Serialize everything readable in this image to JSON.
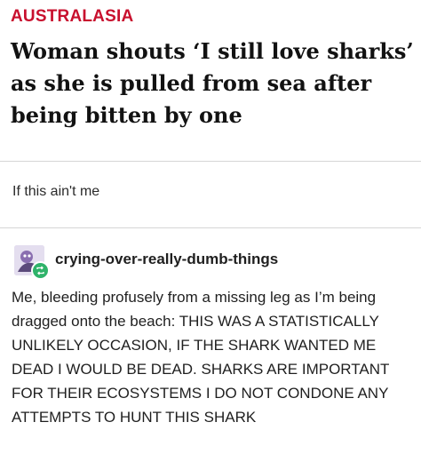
{
  "article": {
    "section": "AUSTRALASIA",
    "headline": "Woman shouts ‘I still love sharks’ as she is pulled from sea after being bitten by one"
  },
  "post": {
    "caption": "If this ain't me"
  },
  "reblog": {
    "username": "crying-over-really-dumb-things",
    "avatar_icon": "reblog-icon",
    "body": "Me, bleeding profusely from a missing leg as I’m being dragged onto the beach: THIS WAS A STATISTICALLY UNLIKELY OCCASION, IF THE SHARK WANTED ME DEAD I WOULD BE DEAD. SHARKS ARE IMPORTANT FOR THEIR ECOSYSTEMS I DO NOT CONDONE ANY ATTEMPTS TO HUNT THIS SHARK"
  },
  "colors": {
    "section_red": "#c8102e",
    "reblog_green": "#2fb36a"
  }
}
